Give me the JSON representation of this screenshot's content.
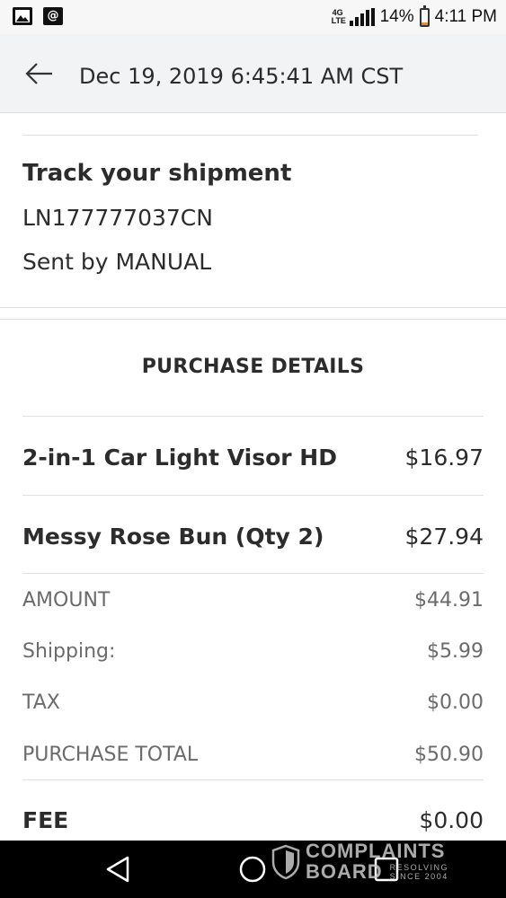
{
  "status_bar": {
    "network": "4G LTE",
    "battery": "14%",
    "battery_level": 0.14,
    "time": "4:11 PM",
    "left_icons": [
      "image-notification-icon",
      "email-notification-icon"
    ],
    "at_symbol": "@"
  },
  "header": {
    "title": "Dec 19, 2019 6:45:41 AM CST",
    "back_icon": "arrow-left-icon"
  },
  "tracking": {
    "title": "Track your shipment",
    "number": "LN177777037CN",
    "sent_by": "Sent by MANUAL"
  },
  "purchase": {
    "section_title": "PURCHASE DETAILS",
    "items": [
      {
        "name": "2-in-1 Car Light Visor HD",
        "price": "$16.97"
      },
      {
        "name": "Messy Rose Bun (Qty 2)",
        "price": "$27.94"
      }
    ],
    "summary": [
      {
        "label": "AMOUNT",
        "value": "$44.91"
      },
      {
        "label": "Shipping:",
        "value": "$5.99"
      },
      {
        "label": "TAX",
        "value": "$0.00"
      },
      {
        "label": "PURCHASE TOTAL",
        "value": "$50.90"
      }
    ],
    "fee": {
      "label": "FEE",
      "value": "$0.00"
    }
  },
  "nav_bar": {
    "buttons": [
      "back-triangle-icon",
      "home-circle-icon",
      "recents-square-icon"
    ]
  },
  "watermark": {
    "line1": "COMPLAINTS",
    "line2": "BOARD",
    "tagline1": "RESOLVING",
    "tagline2": "SINCE 2004"
  },
  "colors": {
    "header_bg": "#f2f3f5",
    "text_primary": "#2c2c2c",
    "text_secondary": "#6b6b6b",
    "divider": "#e0e0e0",
    "battery_fill": "#f28a1e",
    "nav_bg": "#000000"
  }
}
